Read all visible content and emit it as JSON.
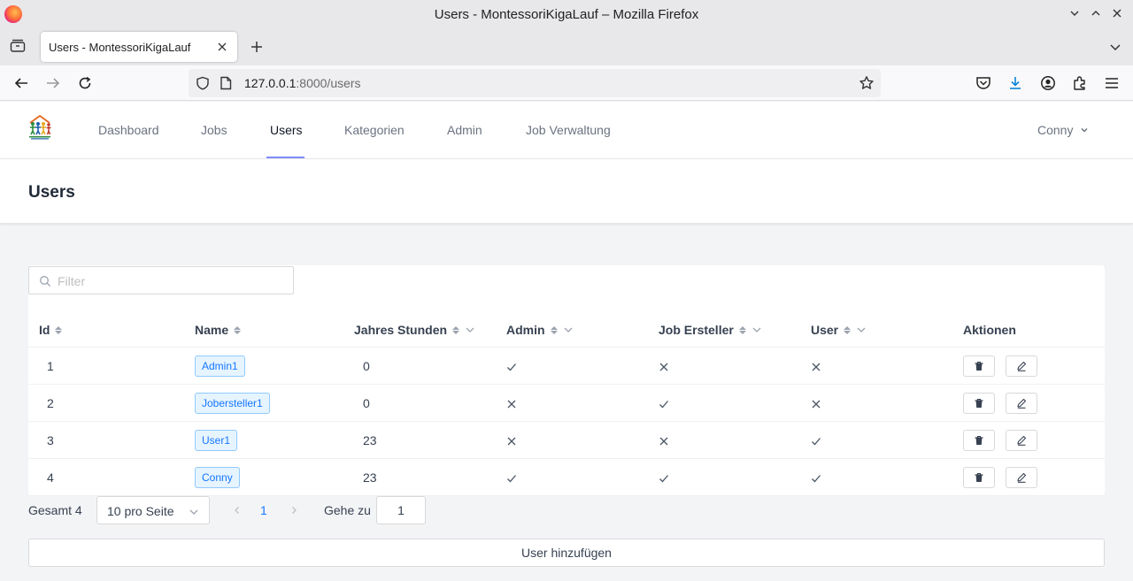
{
  "browser": {
    "window_title": "Users - MontessoriKigaLauf – Mozilla Firefox",
    "tab_title": "Users - MontessoriKigaLauf",
    "url_host": "127.0.0.1",
    "url_rest": ":8000/users"
  },
  "nav": {
    "items": [
      {
        "label": "Dashboard",
        "active": false
      },
      {
        "label": "Jobs",
        "active": false
      },
      {
        "label": "Users",
        "active": true
      },
      {
        "label": "Kategorien",
        "active": false
      },
      {
        "label": "Admin",
        "active": false
      },
      {
        "label": "Job Verwaltung",
        "active": false
      }
    ],
    "user": "Conny"
  },
  "page": {
    "title": "Users"
  },
  "filter": {
    "placeholder": "Filter"
  },
  "table": {
    "columns": [
      "Id",
      "Name",
      "Jahres Stunden",
      "Admin",
      "Job Ersteller",
      "User",
      "Aktionen"
    ],
    "rows": [
      {
        "id": "1",
        "name": "Admin1",
        "hours": "0",
        "admin": true,
        "job_creator": false,
        "user": false
      },
      {
        "id": "2",
        "name": "Jobersteller1",
        "hours": "0",
        "admin": false,
        "job_creator": true,
        "user": false
      },
      {
        "id": "3",
        "name": "User1",
        "hours": "23",
        "admin": false,
        "job_creator": false,
        "user": true
      },
      {
        "id": "4",
        "name": "Conny",
        "hours": "23",
        "admin": true,
        "job_creator": true,
        "user": true
      }
    ]
  },
  "pagination": {
    "total": "Gesamt 4",
    "page_size": "10 pro Seite",
    "current_page": "1",
    "goto_label": "Gehe zu",
    "goto_value": "1"
  },
  "actions": {
    "add_user": "User hinzufügen"
  },
  "colors": {
    "accent": "#818cf8",
    "tag_text": "#1677ff",
    "tag_bg": "#e6f4ff"
  }
}
